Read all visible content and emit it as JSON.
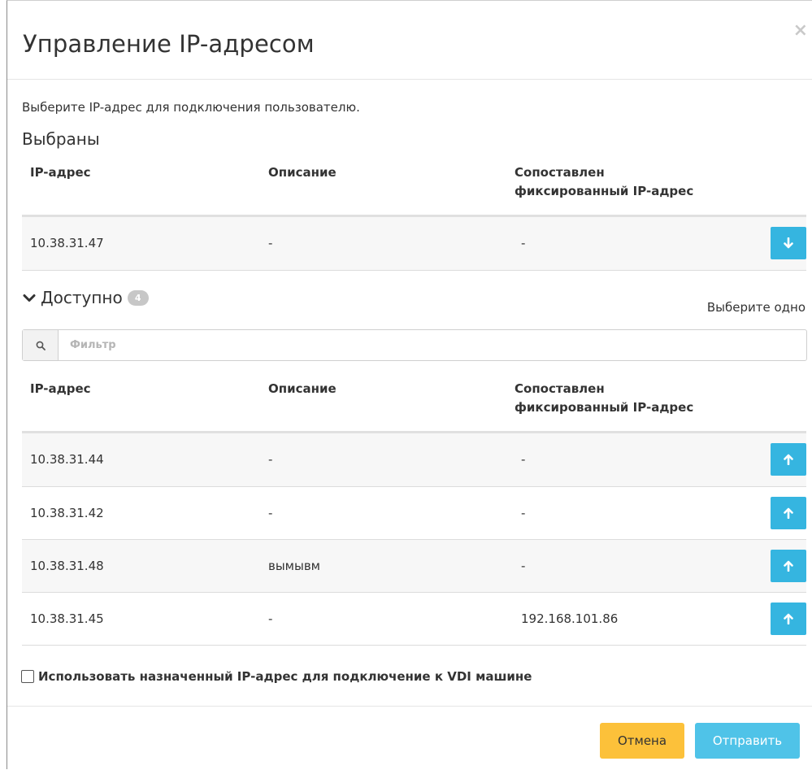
{
  "modal": {
    "title": "Управление IP-адресом",
    "close_label": "×",
    "intro": "Выберите IP-адрес для подключения пользователю."
  },
  "selected": {
    "title": "Выбраны",
    "columns": [
      "IP-адрес",
      "Описание",
      "Сопоставлен\nфиксированный IP-адрес"
    ],
    "rows": [
      {
        "ip": "10.38.31.47",
        "description": "-",
        "fixed_ip": "-"
      }
    ]
  },
  "available": {
    "title": "Доступно",
    "count": "4",
    "choose_label": "Выберите одно",
    "filter_placeholder": "Фильтр",
    "columns": [
      "IP-адрес",
      "Описание",
      "Сопоставлен\nфиксированный IP-адрес"
    ],
    "rows": [
      {
        "ip": "10.38.31.44",
        "description": "-",
        "fixed_ip": "-"
      },
      {
        "ip": "10.38.31.42",
        "description": "-",
        "fixed_ip": "-"
      },
      {
        "ip": "10.38.31.48",
        "description": "вымывм",
        "fixed_ip": "-"
      },
      {
        "ip": "10.38.31.45",
        "description": "-",
        "fixed_ip": "192.168.101.86"
      }
    ]
  },
  "checkbox_label": "Использовать назначенный IP-адрес для подключение к VDI машине",
  "footer": {
    "cancel_label": "Отмена",
    "submit_label": "Отправить"
  },
  "colors": {
    "accent_blue": "#35b5e0",
    "cancel_yellow": "#fcc13a",
    "submit_blue": "#4fc3e8"
  }
}
